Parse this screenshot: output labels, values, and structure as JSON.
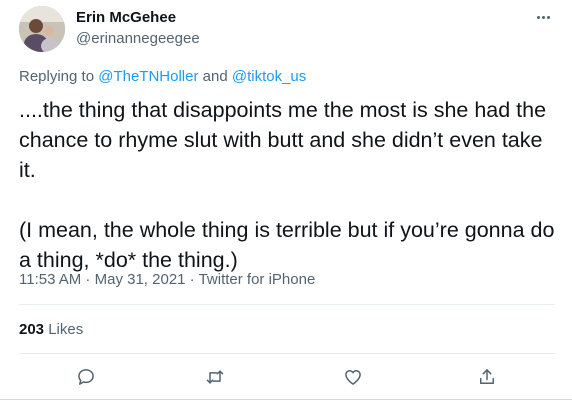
{
  "author": {
    "name": "Erin McGehee",
    "handle": "@erinannegeegee",
    "avatar_icon": "profile-photo"
  },
  "replying": {
    "prefix": "Replying to ",
    "to_1": "@TheTNHoller",
    "and": " and ",
    "to_2": "@tiktok_us"
  },
  "tweet": {
    "paragraph_1": "....the thing that disappoints me the most is she had the chance to rhyme slut with butt and she didn’t even take it.",
    "paragraph_2": "(I mean, the whole thing is terrible but if you’re gonna do a thing, *do* the thing.)"
  },
  "meta": {
    "time": "11:53 AM",
    "sep_1": " · ",
    "date": "May 31, 2021",
    "sep_2": " · ",
    "source": "Twitter for iPhone"
  },
  "likes": {
    "count": "203",
    "label": " Likes"
  },
  "actions": {
    "reply_icon": "reply-icon",
    "retweet_icon": "retweet-icon",
    "like_icon": "heart-icon",
    "share_icon": "share-icon"
  },
  "colors": {
    "link": "#1d9bf0",
    "secondary_text": "#536471",
    "primary_text": "#0f1419"
  }
}
